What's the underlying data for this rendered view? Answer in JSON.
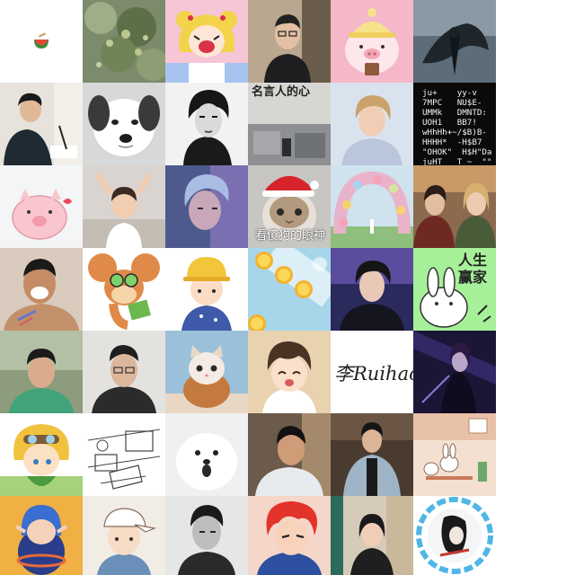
{
  "colors": {
    "background": "#ffffff"
  },
  "avatars": [
    {
      "name": "watermelon-bowl-avatar",
      "icon": "watermelon-icon"
    },
    {
      "name": "green-leaves-avatar",
      "icon": "plant-photo-icon"
    },
    {
      "name": "sailor-moon-avatar",
      "icon": "anime-girl-icon"
    },
    {
      "name": "man-glasses-avatar",
      "icon": "portrait-icon"
    },
    {
      "name": "pig-beanie-avatar",
      "icon": "pig-cartoon-icon"
    },
    {
      "name": "dark-wings-avatar",
      "icon": "fantasy-figure-icon"
    },
    {
      "name": "writing-boy-avatar",
      "icon": "portrait-icon"
    },
    {
      "name": "puppy-avatar",
      "icon": "dog-icon"
    },
    {
      "name": "audrey-portrait-avatar",
      "icon": "portrait-icon"
    },
    {
      "name": "calligraphy-station-avatar",
      "icon": "calligraphy-icon"
    },
    {
      "name": "blond-singer-avatar",
      "icon": "portrait-icon"
    },
    {
      "name": "ascii-art-avatar",
      "icon": "ascii-text-icon"
    },
    {
      "name": "pink-pig-avatar",
      "icon": "pig-cartoon-icon"
    },
    {
      "name": "little-girl-avatar",
      "icon": "child-photo-icon"
    },
    {
      "name": "blue-haired-man-avatar",
      "icon": "portrait-icon"
    },
    {
      "name": "santa-cat-avatar",
      "icon": "cat-icon"
    },
    {
      "name": "flower-arch-avatar",
      "icon": "flower-icon"
    },
    {
      "name": "couple-show-avatar",
      "icon": "portrait-icon"
    },
    {
      "name": "laughing-man-avatar",
      "icon": "portrait-icon"
    },
    {
      "name": "jerry-mouse-avatar",
      "icon": "mouse-cartoon-icon"
    },
    {
      "name": "yellow-hat-kid-avatar",
      "icon": "kid-cartoon-icon"
    },
    {
      "name": "lemon-slices-avatar",
      "icon": "lemon-icon"
    },
    {
      "name": "concert-singer-avatar",
      "icon": "portrait-icon"
    },
    {
      "name": "rabbit-meme-avatar",
      "icon": "rabbit-cartoon-icon"
    },
    {
      "name": "green-shirt-man-avatar",
      "icon": "portrait-icon"
    },
    {
      "name": "glasses-selfie-avatar",
      "icon": "portrait-icon"
    },
    {
      "name": "kitten-avatar",
      "icon": "cat-icon"
    },
    {
      "name": "anime-boy-avatar",
      "icon": "anime-boy-icon"
    },
    {
      "name": "signature-avatar",
      "icon": "signature-icon"
    },
    {
      "name": "dark-warrior-avatar",
      "icon": "fantasy-figure-icon"
    },
    {
      "name": "goggle-boy-cartoon-avatar",
      "icon": "cartoon-icon"
    },
    {
      "name": "sketch-desk-avatar",
      "icon": "sketch-icon"
    },
    {
      "name": "white-dog-avatar",
      "icon": "dog-icon"
    },
    {
      "name": "young-man-avatar",
      "icon": "portrait-icon"
    },
    {
      "name": "fashion-man-avatar",
      "icon": "portrait-icon"
    },
    {
      "name": "bunny-cafe-avatar",
      "icon": "rabbit-cartoon-icon"
    },
    {
      "name": "elf-girl-avatar",
      "icon": "cartoon-icon"
    },
    {
      "name": "cap-boy-avatar",
      "icon": "cartoon-icon"
    },
    {
      "name": "bw-man-avatar",
      "icon": "portrait-icon"
    },
    {
      "name": "redhead-anime-avatar",
      "icon": "anime-boy-icon"
    },
    {
      "name": "girl-doorway-avatar",
      "icon": "portrait-icon"
    },
    {
      "name": "ink-circle-avatar",
      "icon": "ink-art-icon"
    }
  ],
  "texts": {
    "calligraphy": "名言人的心",
    "ascii_art": "ju+    yy-v\n7MPC   NU$E-\nUMMk   DMNTD:\nUOH1   BB7!\nwHhHh+~/$B)B-\nHHHH*  -H$B7\n\"OHOK\"  H$H\"Da\njuHT   T ~  \"\"",
    "cat_caption": "看傻狗的眼神",
    "rabbit_text": "人生赢家",
    "signature": "李Ruihao"
  }
}
